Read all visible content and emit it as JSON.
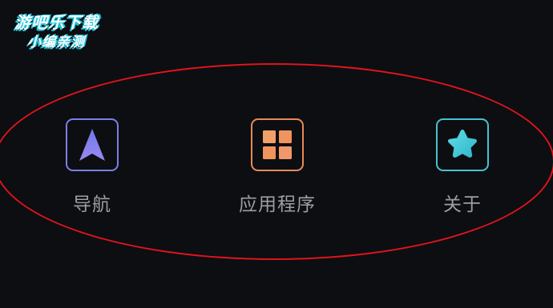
{
  "watermark": {
    "line1": "游吧乐下载",
    "line2": "小编亲测"
  },
  "menu": {
    "items": [
      {
        "label": "导航",
        "icon": "navigation-arrow-icon",
        "accent": "#7a7fe8"
      },
      {
        "label": "应用程序",
        "icon": "apps-grid-icon",
        "accent": "#e88a58"
      },
      {
        "label": "关于",
        "icon": "star-icon",
        "accent": "#47c2d0"
      }
    ]
  },
  "colors": {
    "background": "#0d0e12",
    "highlight": "#e0141b",
    "label": "#9c9ea4"
  }
}
